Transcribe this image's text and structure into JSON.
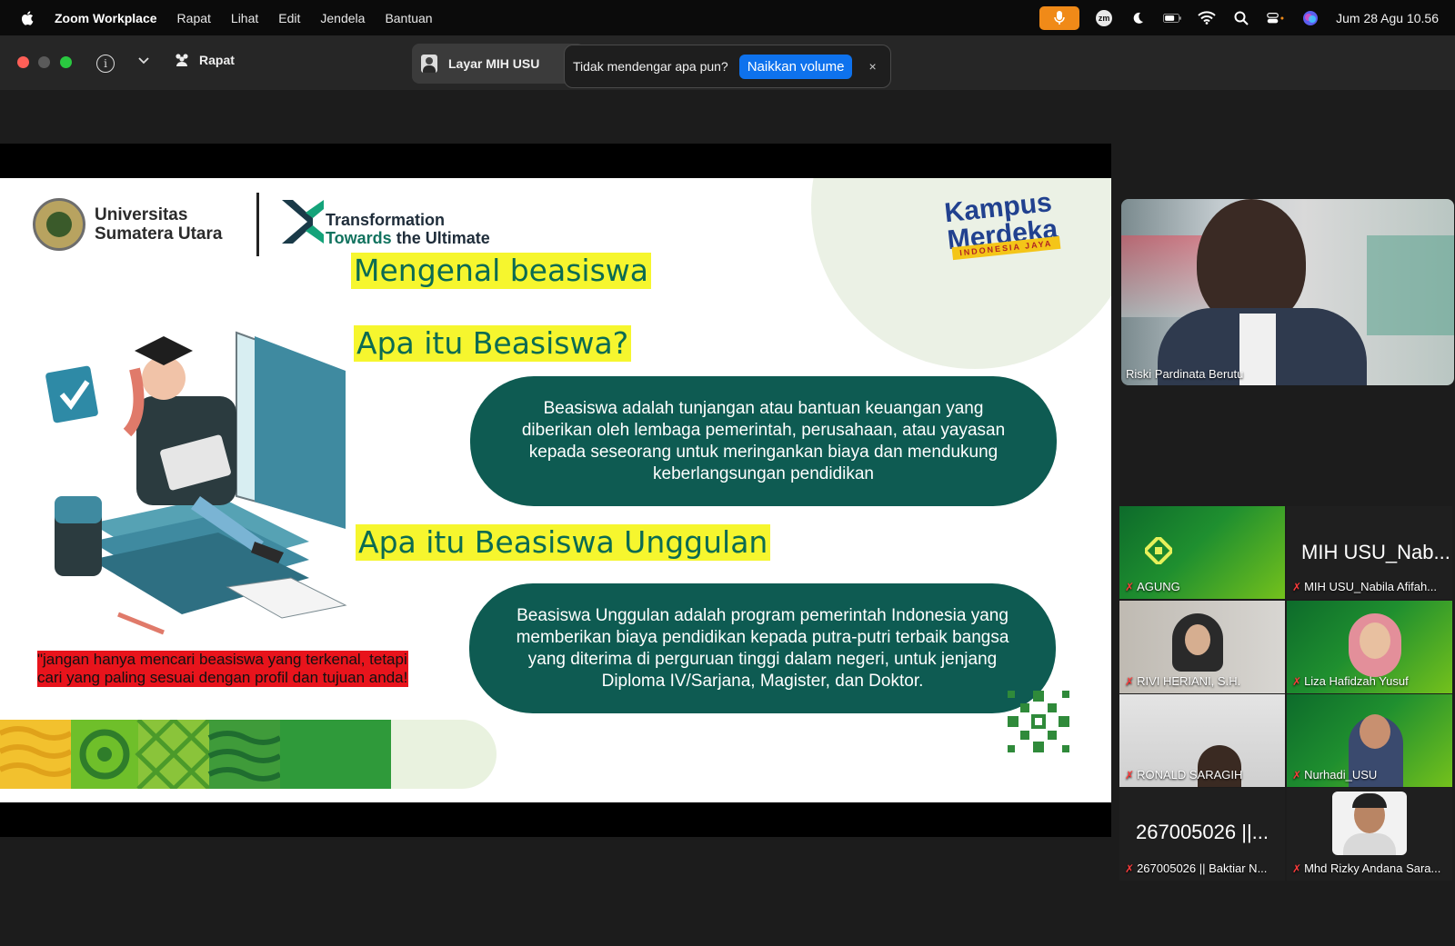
{
  "menubar": {
    "app_name": "Zoom Workplace",
    "menus": [
      "Rapat",
      "Lihat",
      "Edit",
      "Jendela",
      "Bantuan"
    ],
    "clock": "Jum 28 Agu  10.56"
  },
  "toolbar": {
    "meeting_label": "Rapat",
    "shared_screen_label": "Layar MIH USU",
    "notice_text": "Tidak mendengar apa pun?",
    "notice_button": "Naikkan volume",
    "close_glyph": "×"
  },
  "slide": {
    "university": [
      "Universitas",
      "Sumatera Utara"
    ],
    "tagline": [
      "Transformation",
      "Towards",
      "the Ultimate"
    ],
    "kampus_merdeka": [
      "Kampus",
      "Merdeka"
    ],
    "kampus_tag": "INDONESIA JAYA",
    "heading_main": "Mengenal beasiswa",
    "heading_q1": "Apa itu Beasiswa?",
    "answer1": "Beasiswa adalah tunjangan atau bantuan keuangan yang diberikan oleh lembaga pemerintah, perusahaan, atau yayasan kepada seseorang untuk meringankan biaya dan mendukung keberlangsungan pendidikan",
    "heading_q2": "Apa itu Beasiswa Unggulan",
    "answer2": "Beasiswa Unggulan adalah program pemerintah Indonesia yang memberikan biaya pendidikan kepada putra-putri terbaik bangsa yang diterima di perguruan tinggi dalam negeri, untuk jenjang Diploma IV/Sarjana, Magister, dan Doktor.",
    "quote": "\"jangan hanya mencari beasiswa yang terkenal, tetapi cari yang paling sesuai dengan profil dan tujuan anda!"
  },
  "speaker": {
    "name": "Riski Pardinata Berutu"
  },
  "gallery": {
    "tiles": [
      {
        "name": "AGUNG"
      },
      {
        "name": "MIH USU_Nabila Afifah...",
        "display": "MIH USU_Nab..."
      },
      {
        "name": "RIVI HERIANI, S.H."
      },
      {
        "name": "Liza Hafidzah Yusuf"
      },
      {
        "name": "RONALD SARAGIH"
      },
      {
        "name": "Nurhadi_USU"
      },
      {
        "name": "267005026 || Baktiar N...",
        "display": "267005026 ||..."
      },
      {
        "name": "Mhd Rizky Andana Sara..."
      }
    ]
  },
  "colors": {
    "slide_teal": "#0e5b52",
    "highlight_yellow": "#f6f62e",
    "zoom_blue": "#0e72ed",
    "mic_orange": "#f08a18"
  }
}
